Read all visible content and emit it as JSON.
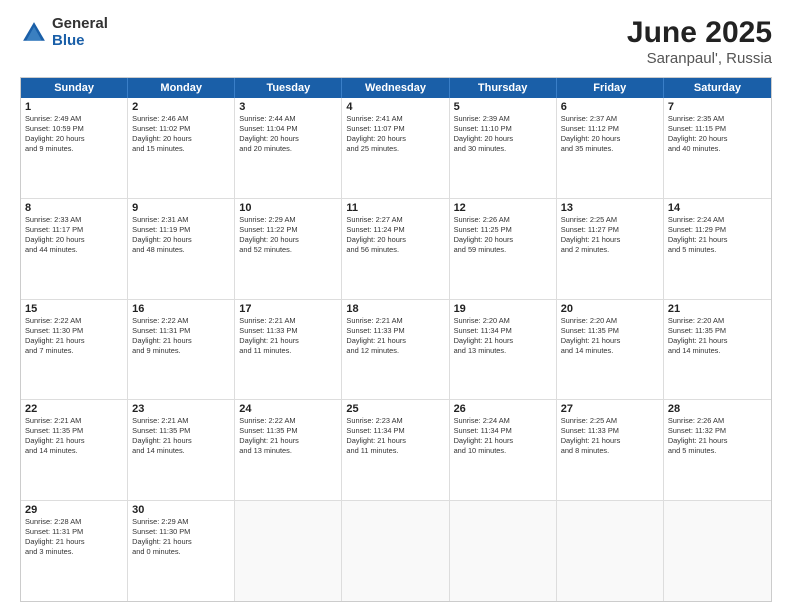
{
  "logo": {
    "general": "General",
    "blue": "Blue"
  },
  "title": {
    "month": "June 2025",
    "location": "Saranpaul', Russia"
  },
  "header_days": [
    "Sunday",
    "Monday",
    "Tuesday",
    "Wednesday",
    "Thursday",
    "Friday",
    "Saturday"
  ],
  "rows": [
    [
      {
        "day": "1",
        "lines": [
          "Sunrise: 2:49 AM",
          "Sunset: 10:59 PM",
          "Daylight: 20 hours",
          "and 9 minutes."
        ]
      },
      {
        "day": "2",
        "lines": [
          "Sunrise: 2:46 AM",
          "Sunset: 11:02 PM",
          "Daylight: 20 hours",
          "and 15 minutes."
        ]
      },
      {
        "day": "3",
        "lines": [
          "Sunrise: 2:44 AM",
          "Sunset: 11:04 PM",
          "Daylight: 20 hours",
          "and 20 minutes."
        ]
      },
      {
        "day": "4",
        "lines": [
          "Sunrise: 2:41 AM",
          "Sunset: 11:07 PM",
          "Daylight: 20 hours",
          "and 25 minutes."
        ]
      },
      {
        "day": "5",
        "lines": [
          "Sunrise: 2:39 AM",
          "Sunset: 11:10 PM",
          "Daylight: 20 hours",
          "and 30 minutes."
        ]
      },
      {
        "day": "6",
        "lines": [
          "Sunrise: 2:37 AM",
          "Sunset: 11:12 PM",
          "Daylight: 20 hours",
          "and 35 minutes."
        ]
      },
      {
        "day": "7",
        "lines": [
          "Sunrise: 2:35 AM",
          "Sunset: 11:15 PM",
          "Daylight: 20 hours",
          "and 40 minutes."
        ]
      }
    ],
    [
      {
        "day": "8",
        "lines": [
          "Sunrise: 2:33 AM",
          "Sunset: 11:17 PM",
          "Daylight: 20 hours",
          "and 44 minutes."
        ]
      },
      {
        "day": "9",
        "lines": [
          "Sunrise: 2:31 AM",
          "Sunset: 11:19 PM",
          "Daylight: 20 hours",
          "and 48 minutes."
        ]
      },
      {
        "day": "10",
        "lines": [
          "Sunrise: 2:29 AM",
          "Sunset: 11:22 PM",
          "Daylight: 20 hours",
          "and 52 minutes."
        ]
      },
      {
        "day": "11",
        "lines": [
          "Sunrise: 2:27 AM",
          "Sunset: 11:24 PM",
          "Daylight: 20 hours",
          "and 56 minutes."
        ]
      },
      {
        "day": "12",
        "lines": [
          "Sunrise: 2:26 AM",
          "Sunset: 11:25 PM",
          "Daylight: 20 hours",
          "and 59 minutes."
        ]
      },
      {
        "day": "13",
        "lines": [
          "Sunrise: 2:25 AM",
          "Sunset: 11:27 PM",
          "Daylight: 21 hours",
          "and 2 minutes."
        ]
      },
      {
        "day": "14",
        "lines": [
          "Sunrise: 2:24 AM",
          "Sunset: 11:29 PM",
          "Daylight: 21 hours",
          "and 5 minutes."
        ]
      }
    ],
    [
      {
        "day": "15",
        "lines": [
          "Sunrise: 2:22 AM",
          "Sunset: 11:30 PM",
          "Daylight: 21 hours",
          "and 7 minutes."
        ]
      },
      {
        "day": "16",
        "lines": [
          "Sunrise: 2:22 AM",
          "Sunset: 11:31 PM",
          "Daylight: 21 hours",
          "and 9 minutes."
        ]
      },
      {
        "day": "17",
        "lines": [
          "Sunrise: 2:21 AM",
          "Sunset: 11:33 PM",
          "Daylight: 21 hours",
          "and 11 minutes."
        ]
      },
      {
        "day": "18",
        "lines": [
          "Sunrise: 2:21 AM",
          "Sunset: 11:33 PM",
          "Daylight: 21 hours",
          "and 12 minutes."
        ]
      },
      {
        "day": "19",
        "lines": [
          "Sunrise: 2:20 AM",
          "Sunset: 11:34 PM",
          "Daylight: 21 hours",
          "and 13 minutes."
        ]
      },
      {
        "day": "20",
        "lines": [
          "Sunrise: 2:20 AM",
          "Sunset: 11:35 PM",
          "Daylight: 21 hours",
          "and 14 minutes."
        ]
      },
      {
        "day": "21",
        "lines": [
          "Sunrise: 2:20 AM",
          "Sunset: 11:35 PM",
          "Daylight: 21 hours",
          "and 14 minutes."
        ]
      }
    ],
    [
      {
        "day": "22",
        "lines": [
          "Sunrise: 2:21 AM",
          "Sunset: 11:35 PM",
          "Daylight: 21 hours",
          "and 14 minutes."
        ]
      },
      {
        "day": "23",
        "lines": [
          "Sunrise: 2:21 AM",
          "Sunset: 11:35 PM",
          "Daylight: 21 hours",
          "and 14 minutes."
        ]
      },
      {
        "day": "24",
        "lines": [
          "Sunrise: 2:22 AM",
          "Sunset: 11:35 PM",
          "Daylight: 21 hours",
          "and 13 minutes."
        ]
      },
      {
        "day": "25",
        "lines": [
          "Sunrise: 2:23 AM",
          "Sunset: 11:34 PM",
          "Daylight: 21 hours",
          "and 11 minutes."
        ]
      },
      {
        "day": "26",
        "lines": [
          "Sunrise: 2:24 AM",
          "Sunset: 11:34 PM",
          "Daylight: 21 hours",
          "and 10 minutes."
        ]
      },
      {
        "day": "27",
        "lines": [
          "Sunrise: 2:25 AM",
          "Sunset: 11:33 PM",
          "Daylight: 21 hours",
          "and 8 minutes."
        ]
      },
      {
        "day": "28",
        "lines": [
          "Sunrise: 2:26 AM",
          "Sunset: 11:32 PM",
          "Daylight: 21 hours",
          "and 5 minutes."
        ]
      }
    ],
    [
      {
        "day": "29",
        "lines": [
          "Sunrise: 2:28 AM",
          "Sunset: 11:31 PM",
          "Daylight: 21 hours",
          "and 3 minutes."
        ]
      },
      {
        "day": "30",
        "lines": [
          "Sunrise: 2:29 AM",
          "Sunset: 11:30 PM",
          "Daylight: 21 hours",
          "and 0 minutes."
        ]
      },
      {
        "day": "",
        "lines": []
      },
      {
        "day": "",
        "lines": []
      },
      {
        "day": "",
        "lines": []
      },
      {
        "day": "",
        "lines": []
      },
      {
        "day": "",
        "lines": []
      }
    ]
  ]
}
